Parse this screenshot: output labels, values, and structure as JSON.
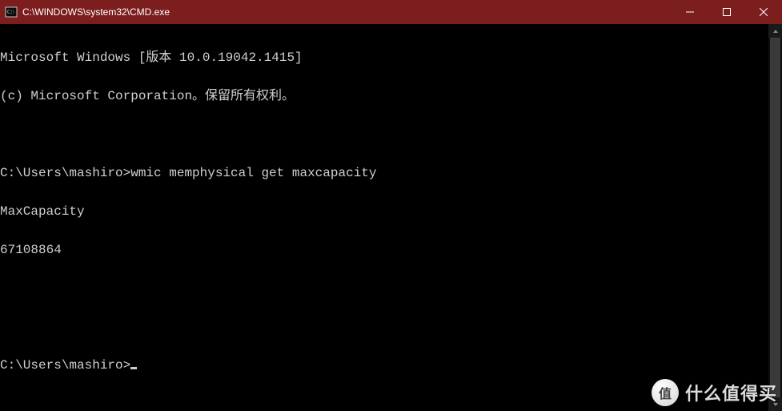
{
  "window": {
    "title": "C:\\WINDOWS\\system32\\CMD.exe"
  },
  "console": {
    "lines": [
      "Microsoft Windows [版本 10.0.19042.1415]",
      "(c) Microsoft Corporation。保留所有权利。",
      "",
      "C:\\Users\\mashiro>wmic memphysical get maxcapacity",
      "MaxCapacity",
      "67108864",
      "",
      ""
    ],
    "prompt": "C:\\Users\\mashiro>"
  },
  "watermark": {
    "badge": "值",
    "text": "什么值得买"
  }
}
